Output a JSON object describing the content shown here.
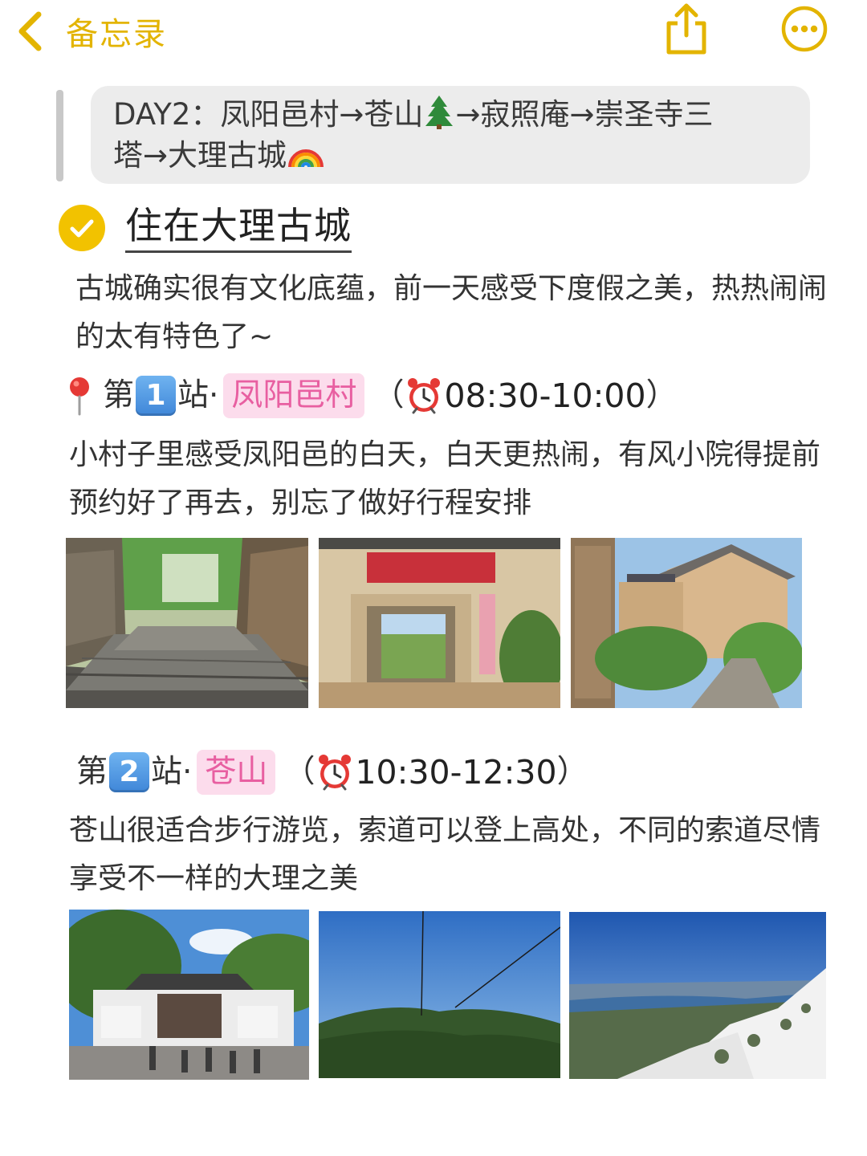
{
  "nav": {
    "back_label": "备忘录"
  },
  "quote": {
    "line_text_1": "DAY2：凤阳邑村→苍山",
    "line_text_2": "→寂照庵→崇圣寺三",
    "line_text_3": "塔→大理古城"
  },
  "heading": {
    "title": "住在大理古城"
  },
  "intro": {
    "text": "古城确实很有文化底蕴，前一天感受下度假之美，热热闹闹的太有特色了~"
  },
  "stations": [
    {
      "prefix": "第",
      "number": "1",
      "suffix": "站·",
      "place": "凤阳邑村",
      "open_paren": "（",
      "time": "08:30-10:00",
      "close_paren": "）",
      "description": "小村子里感受凤阳邑的白天，白天更热闹，有风小院得提前预约好了再去，别忘了做好行程安排"
    },
    {
      "prefix": "第",
      "number": "2",
      "suffix": "站·",
      "place": "苍山",
      "open_paren": "（",
      "time": "10:30-12:30",
      "close_paren": "）",
      "description": "苍山很适合步行游览，索道可以登上高处，不同的索道尽情享受不一样的大理之美"
    }
  ],
  "colors": {
    "accent_yellow": "#E3B400",
    "tag_pink_bg": "#fcdcec",
    "tag_pink_text": "#e85fa1",
    "quote_bg": "#ececec"
  },
  "icons": [
    "chevron-left-icon",
    "share-icon",
    "more-icon",
    "tree-icon",
    "rainbow-icon",
    "check-circle-icon",
    "pin-icon",
    "alarm-clock-icon"
  ]
}
